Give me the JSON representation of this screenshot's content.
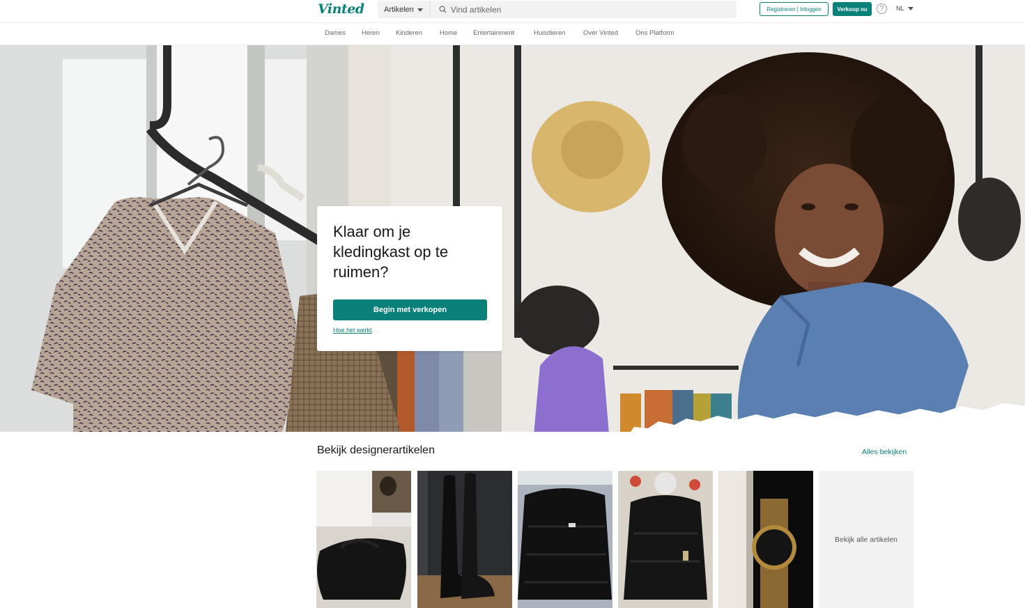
{
  "brand": {
    "logo_text": "Vinted",
    "accent": "#09807a"
  },
  "header": {
    "category_label": "Artikelen",
    "search_placeholder": "Vind artikelen",
    "register_label": "Registreren | Inloggen",
    "sell_label": "Verkoop nu",
    "help_icon": "help-icon",
    "help_glyph": "?",
    "language": "NL"
  },
  "nav": {
    "items": [
      {
        "label": "Dames"
      },
      {
        "label": "Heren"
      },
      {
        "label": "Kinderen"
      },
      {
        "label": "Home"
      },
      {
        "label": "Entertainment"
      },
      {
        "label": "Huisdieren"
      },
      {
        "label": "Over Vinted"
      },
      {
        "label": "Ons Platform"
      }
    ]
  },
  "hero": {
    "title": "Klaar om je kledingkast op te ruimen?",
    "cta_label": "Begin met verkopen",
    "link_label": "Hoe het werkt"
  },
  "designer": {
    "title": "Bekijk designerartikelen",
    "see_all": "Alles bekijken",
    "items": [
      {
        "name": "bag-photo"
      },
      {
        "name": "boots-photo"
      },
      {
        "name": "puffer-jacket-photo"
      },
      {
        "name": "puffer-jacket-photo"
      },
      {
        "name": "watch-photo"
      }
    ],
    "more_label": "Bekijk alle artikelen"
  }
}
